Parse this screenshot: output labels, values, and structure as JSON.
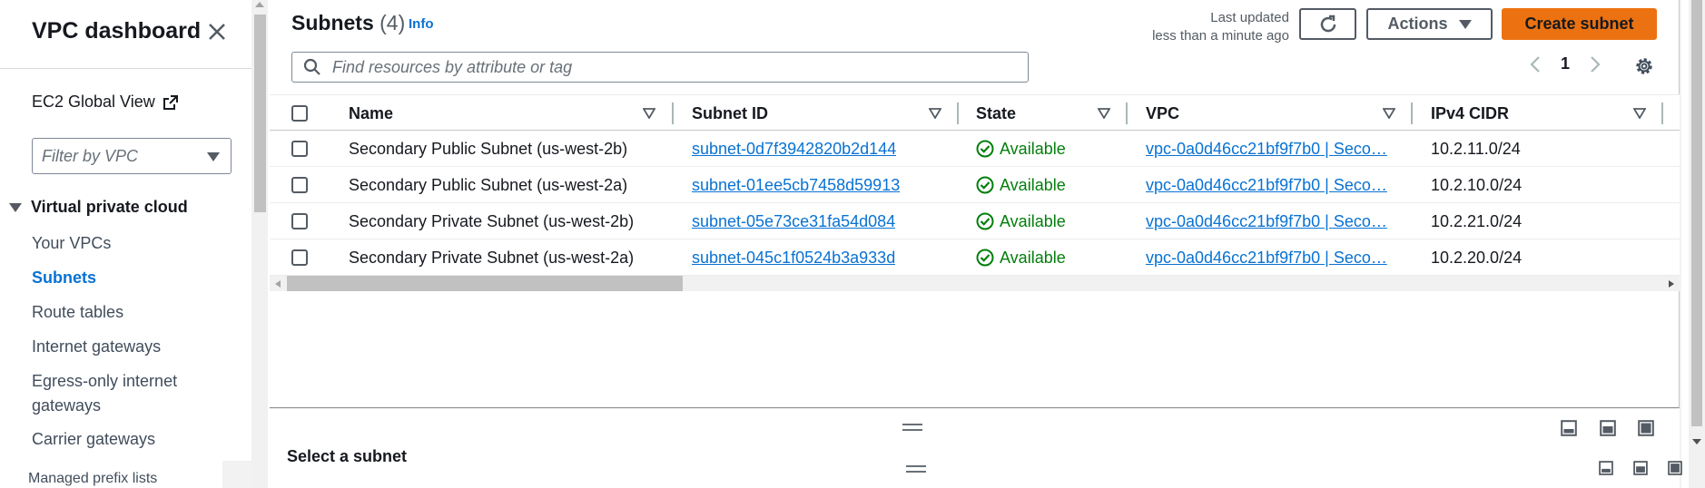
{
  "sidebar": {
    "title": "VPC dashboard",
    "global_view": "EC2 Global View",
    "filter_placeholder": "Filter by VPC",
    "section": "Virtual private cloud",
    "items": [
      {
        "label": "Your VPCs"
      },
      {
        "label": "Subnets"
      },
      {
        "label": "Route tables"
      },
      {
        "label": "Internet gateways"
      },
      {
        "label": "Egress-only internet"
      },
      {
        "label": "gateways"
      },
      {
        "label": "Carrier gateways"
      },
      {
        "label": "Managed prefix lists"
      }
    ]
  },
  "header": {
    "title": "Subnets",
    "count": "(4)",
    "info": "Info",
    "last_updated_1": "Last updated",
    "last_updated_2": "less than a minute ago",
    "actions": "Actions",
    "create": "Create subnet",
    "search_placeholder": "Find resources by attribute or tag",
    "page": "1"
  },
  "table": {
    "columns": [
      "Name",
      "Subnet ID",
      "State",
      "VPC",
      "IPv4 CIDR"
    ],
    "rows": [
      {
        "name": "Secondary Public Subnet (us-west-2b)",
        "subnet_id": "subnet-0d7f3942820b2d144",
        "state": "Available",
        "vpc": "vpc-0a0d46cc21bf9f7b0 | Seco…",
        "cidr": "10.2.11.0/24"
      },
      {
        "name": "Secondary Public Subnet (us-west-2a)",
        "subnet_id": "subnet-01ee5cb7458d59913",
        "state": "Available",
        "vpc": "vpc-0a0d46cc21bf9f7b0 | Seco…",
        "cidr": "10.2.10.0/24"
      },
      {
        "name": "Secondary Private Subnet (us-west-2b)",
        "subnet_id": "subnet-05e73ce31fa54d084",
        "state": "Available",
        "vpc": "vpc-0a0d46cc21bf9f7b0 | Seco…",
        "cidr": "10.2.21.0/24"
      },
      {
        "name": "Secondary Private Subnet (us-west-2a)",
        "subnet_id": "subnet-045c1f0524b3a933d",
        "state": "Available",
        "vpc": "vpc-0a0d46cc21bf9f7b0 | Seco…",
        "cidr": "10.2.20.0/24"
      }
    ]
  },
  "bottom": {
    "title": "Select a subnet"
  },
  "colors": {
    "accent": "#0972d3",
    "primary_button": "#ec7211",
    "status_ok": "#037f0c"
  }
}
